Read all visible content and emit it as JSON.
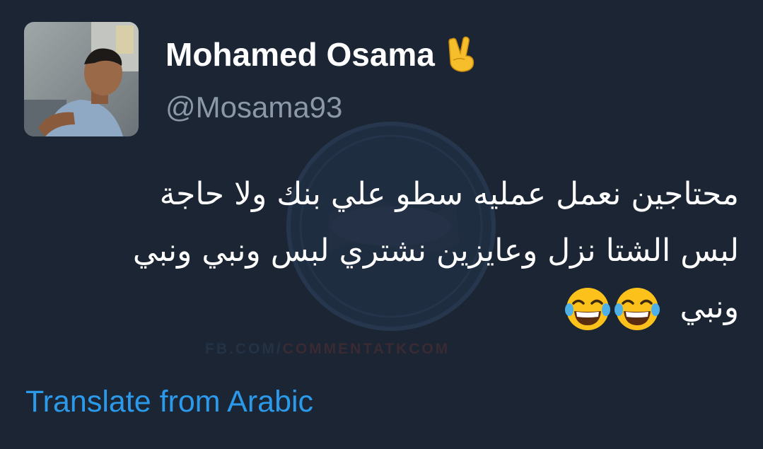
{
  "tweet": {
    "display_name": "Mohamed Osama",
    "name_emoji": "victory-hand-icon",
    "handle": "@Mosama93",
    "text_lines": [
      "محتاجين نعمل عمليه سطو علي بنك ولا حاجة",
      "لبس الشتا نزل وعايزين نشتري لبس ونبي ونبي",
      "ونبي"
    ],
    "trailing_emojis": [
      "face-with-tears-of-joy-icon",
      "face-with-tears-of-joy-icon"
    ],
    "translate_label": "Translate from Arabic"
  },
  "watermark": {
    "footer_prefix": "FB.COM/",
    "footer_brand": "COMMENTATKCOM"
  },
  "colors": {
    "background": "#1b2533",
    "text": "#ffffff",
    "handle": "#8b98a8",
    "link": "#2c9aea"
  }
}
